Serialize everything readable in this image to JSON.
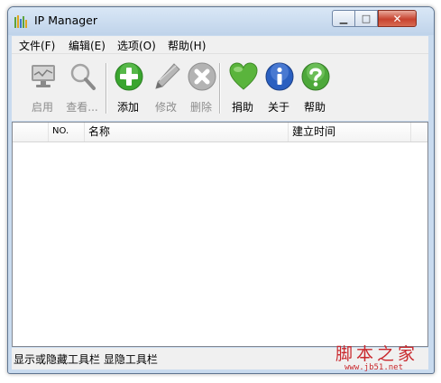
{
  "window": {
    "title": "IP Manager"
  },
  "menu": [
    "文件(F)",
    "编辑(E)",
    "选项(O)",
    "帮助(H)"
  ],
  "toolbar": {
    "buttons": [
      {
        "label": "启用",
        "icon": "monitor-icon",
        "enabled": false
      },
      {
        "label": "查看...",
        "icon": "magnifier-icon",
        "enabled": false
      },
      {
        "label": "添加",
        "icon": "add-icon",
        "enabled": true,
        "color": "#3aa52f"
      },
      {
        "label": "修改",
        "icon": "pencil-icon",
        "enabled": false
      },
      {
        "label": "删除",
        "icon": "delete-icon",
        "enabled": false
      },
      {
        "label": "捐助",
        "icon": "heart-icon",
        "enabled": true,
        "color": "#5ab43c"
      },
      {
        "label": "关于",
        "icon": "info-icon",
        "enabled": true,
        "color": "#2a5fc0"
      },
      {
        "label": "帮助",
        "icon": "help-icon",
        "enabled": true,
        "color": "#4da83a"
      }
    ]
  },
  "list": {
    "columns": [
      "NO.",
      "名称",
      "建立时间"
    ],
    "rows": []
  },
  "status": {
    "text": "显示或隐藏工具栏 显隐工具栏"
  },
  "watermark": {
    "text": "脚本之家",
    "url": "www.jb51.net"
  }
}
